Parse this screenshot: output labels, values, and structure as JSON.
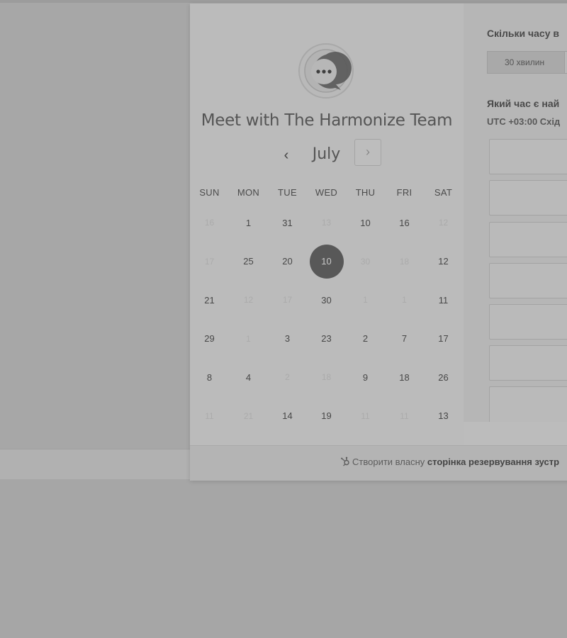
{
  "organizer": {
    "title": "Meet with The Harmonize Team"
  },
  "calendar": {
    "month": "July",
    "prev_glyph": "‹",
    "next_glyph": "›",
    "weekdays": [
      "SUN",
      "MON",
      "TUE",
      "WED",
      "THU",
      "FRI",
      "SAT"
    ],
    "selected_day": "10",
    "weeks": [
      [
        {
          "d": "16",
          "s": "dim"
        },
        {
          "d": "1",
          "s": "avail"
        },
        {
          "d": "31",
          "s": "avail"
        },
        {
          "d": "13",
          "s": "dim"
        },
        {
          "d": "10",
          "s": "avail"
        },
        {
          "d": "16",
          "s": "avail"
        },
        {
          "d": "12",
          "s": "dim"
        }
      ],
      [
        {
          "d": "17",
          "s": "dim"
        },
        {
          "d": "25",
          "s": "avail"
        },
        {
          "d": "20",
          "s": "avail"
        },
        {
          "d": "10",
          "s": "selected"
        },
        {
          "d": "30",
          "s": "dim"
        },
        {
          "d": "18",
          "s": "dim"
        },
        {
          "d": "12",
          "s": "avail"
        }
      ],
      [
        {
          "d": "21",
          "s": "avail"
        },
        {
          "d": "12",
          "s": "dim"
        },
        {
          "d": "17",
          "s": "dim"
        },
        {
          "d": "30",
          "s": "avail"
        },
        {
          "d": "1",
          "s": "dim"
        },
        {
          "d": "1",
          "s": "dim"
        },
        {
          "d": "11",
          "s": "avail"
        }
      ],
      [
        {
          "d": "29",
          "s": "avail"
        },
        {
          "d": "1",
          "s": "dim"
        },
        {
          "d": "3",
          "s": "avail"
        },
        {
          "d": "23",
          "s": "avail"
        },
        {
          "d": "2",
          "s": "avail"
        },
        {
          "d": "7",
          "s": "avail"
        },
        {
          "d": "17",
          "s": "avail"
        }
      ],
      [
        {
          "d": "8",
          "s": "avail"
        },
        {
          "d": "4",
          "s": "avail"
        },
        {
          "d": "2",
          "s": "dim"
        },
        {
          "d": "18",
          "s": "dim"
        },
        {
          "d": "9",
          "s": "avail"
        },
        {
          "d": "18",
          "s": "avail"
        },
        {
          "d": "26",
          "s": "avail"
        }
      ],
      [
        {
          "d": "11",
          "s": "dim"
        },
        {
          "d": "21",
          "s": "dim"
        },
        {
          "d": "14",
          "s": "avail"
        },
        {
          "d": "19",
          "s": "avail"
        },
        {
          "d": "11",
          "s": "dim"
        },
        {
          "d": "11",
          "s": "dim"
        },
        {
          "d": "13",
          "s": "avail"
        }
      ]
    ]
  },
  "booking": {
    "duration_question": "Скільки часу в",
    "duration_option": "30 хвилин",
    "time_question": "Який час є най",
    "timezone_prefix": "UTC +03:00",
    "timezone_name": "Схід"
  },
  "footer": {
    "text_prefix": "Створити власну",
    "text_bold": "сторінка резервування зустр"
  }
}
